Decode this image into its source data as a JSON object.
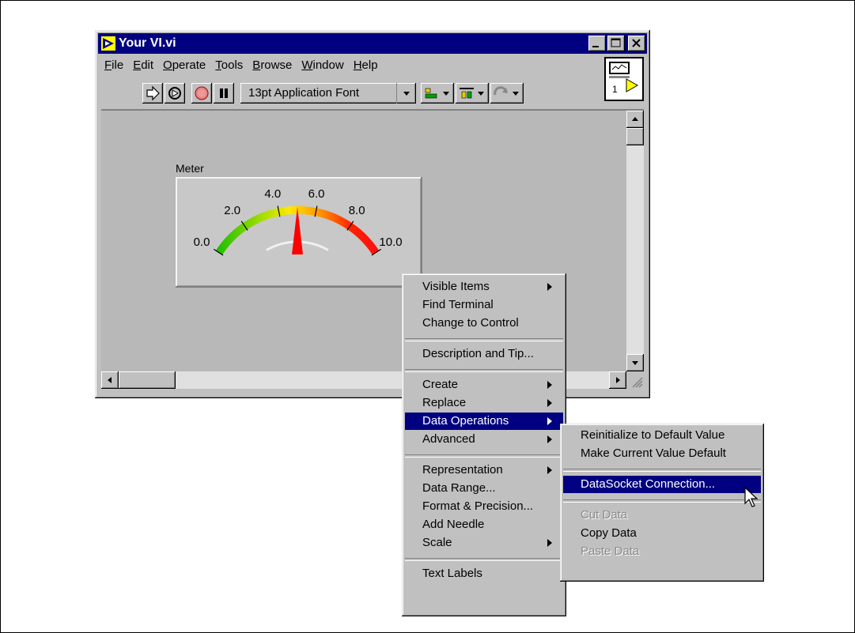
{
  "window": {
    "title": "Your VI.vi",
    "menus": [
      {
        "u": "F",
        "rest": "ile"
      },
      {
        "u": "E",
        "rest": "dit"
      },
      {
        "u": "O",
        "rest": "perate"
      },
      {
        "u": "T",
        "rest": "ools"
      },
      {
        "u": "B",
        "rest": "rowse"
      },
      {
        "u": "W",
        "rest": "indow"
      },
      {
        "u": "H",
        "rest": "elp"
      }
    ],
    "font_selector": "13pt Application Font",
    "icon_label": "1"
  },
  "meter": {
    "label": "Meter",
    "scale_min": 0,
    "scale_max": 10,
    "needle_value": 5.0,
    "ticks": [
      "0.0",
      "2.0",
      "4.0",
      "6.0",
      "8.0",
      "10.0"
    ]
  },
  "context_menu": {
    "items": [
      {
        "label": "Visible Items",
        "submenu": true
      },
      {
        "label": "Find Terminal"
      },
      {
        "label": "Change to Control"
      },
      {
        "label": "Description and Tip..."
      },
      {
        "label": "Create",
        "submenu": true
      },
      {
        "label": "Replace",
        "submenu": true
      },
      {
        "label": "Data Operations",
        "submenu": true,
        "highlighted": true
      },
      {
        "label": "Advanced",
        "submenu": true
      },
      {
        "label": "Representation",
        "submenu": true
      },
      {
        "label": "Data Range..."
      },
      {
        "label": "Format & Precision..."
      },
      {
        "label": "Add Needle"
      },
      {
        "label": "Scale",
        "submenu": true
      },
      {
        "label": "Text Labels"
      }
    ]
  },
  "submenu": {
    "items": [
      {
        "label": "Reinitialize to Default Value"
      },
      {
        "label": "Make Current Value Default"
      },
      {
        "label": "DataSocket Connection...",
        "highlighted": true
      },
      {
        "label": "Cut Data",
        "disabled": true
      },
      {
        "label": "Copy Data"
      },
      {
        "label": "Paste Data",
        "disabled": true
      }
    ]
  },
  "colors": {
    "titlebar": "#000080",
    "highlight": "#000080",
    "window_bg": "#c0c0c0",
    "needle": "#ff0000"
  }
}
